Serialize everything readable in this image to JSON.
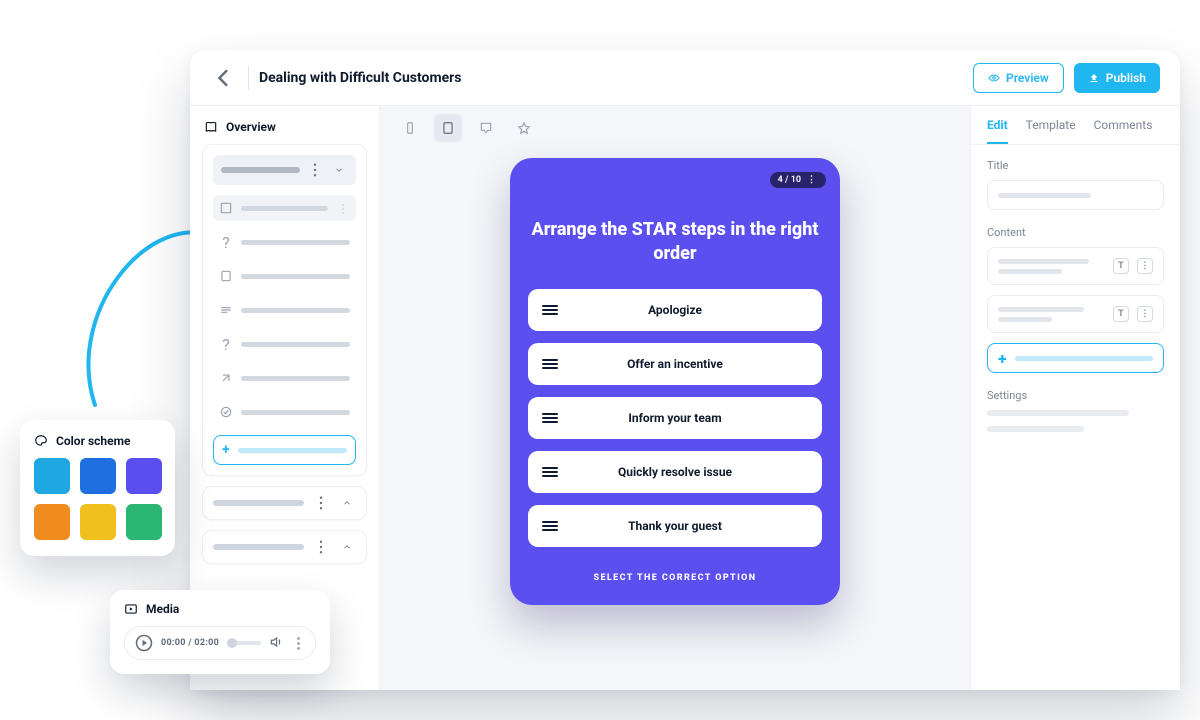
{
  "header": {
    "title": "Dealing with Difficult Customers",
    "preview_label": "Preview",
    "publish_label": "Publish"
  },
  "left": {
    "overview_label": "Overview"
  },
  "phone": {
    "page_indicator": "4 / 10",
    "title": "Arrange the STAR steps in the right order",
    "options": [
      "Apologize",
      "Offer an incentive",
      "Inform your team",
      "Quickly resolve issue",
      "Thank your guest"
    ],
    "footer": "SELECT THE CORRECT OPTION"
  },
  "right": {
    "tabs": {
      "edit": "Edit",
      "template": "Template",
      "comments": "Comments"
    },
    "title_label": "Title",
    "content_label": "Content",
    "settings_label": "Settings"
  },
  "color_card": {
    "label": "Color scheme",
    "colors": [
      "#1ea7e1",
      "#1f6fe0",
      "#5b4ff0",
      "#f08b1f",
      "#f0c01f",
      "#2bb673"
    ]
  },
  "media_card": {
    "label": "Media",
    "time": "00:00 / 02:00"
  }
}
